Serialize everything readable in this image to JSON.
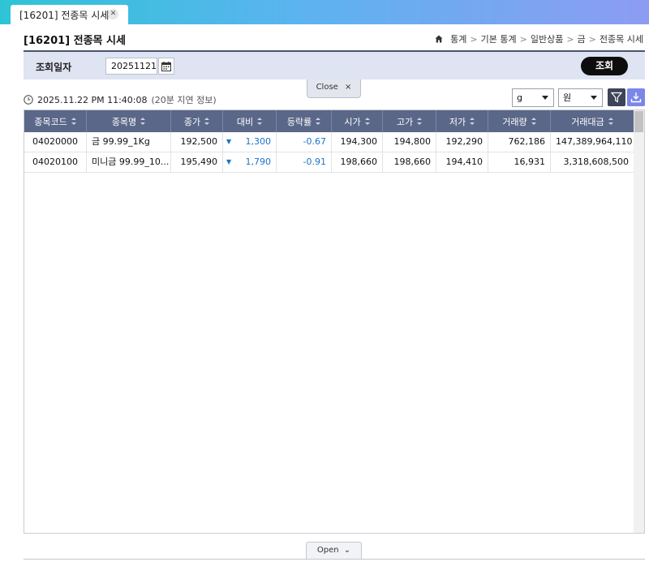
{
  "tab": {
    "label": "[16201] 전종목 시세",
    "close": "✕"
  },
  "header": {
    "title": "[16201] 전종목 시세",
    "breadcrumb": [
      "통계",
      "기본 통계",
      "일반상품",
      "금",
      "전종목 시세"
    ]
  },
  "search": {
    "label": "조회일자",
    "date_value": "20251121",
    "query_button": "조회"
  },
  "panel": {
    "close_label": "Close",
    "close_icon": "×",
    "open_label": "Open"
  },
  "timestamp": {
    "time": "2025.11.22 PM 11:40:08",
    "note": "(20분 지연 정보)"
  },
  "controls": {
    "unit_select": "g",
    "currency_select": "원",
    "filter_icon": "filter-icon",
    "download_icon": "download-icon"
  },
  "table": {
    "columns": [
      "종목코드",
      "종목명",
      "종가",
      "대비",
      "등락률",
      "시가",
      "고가",
      "저가",
      "거래량",
      "거래대금"
    ],
    "rows": [
      {
        "code": "04020000",
        "name": "금 99.99_1Kg",
        "close": "192,500",
        "change": "1,300",
        "rate": "-0.67",
        "open": "194,300",
        "high": "194,800",
        "low": "192,290",
        "volume": "762,186",
        "amount": "147,389,964,110"
      },
      {
        "code": "04020100",
        "name": "미니금 99.99_10...",
        "close": "195,490",
        "change": "1,790",
        "rate": "-0.91",
        "open": "198,660",
        "high": "198,660",
        "low": "194,410",
        "volume": "16,931",
        "amount": "3,318,608,500"
      }
    ]
  },
  "colors": {
    "header_bg": "#5a6788",
    "down": "#1a73c8",
    "search_bg": "#dfe4f2",
    "download_btn": "#7b86e8"
  }
}
